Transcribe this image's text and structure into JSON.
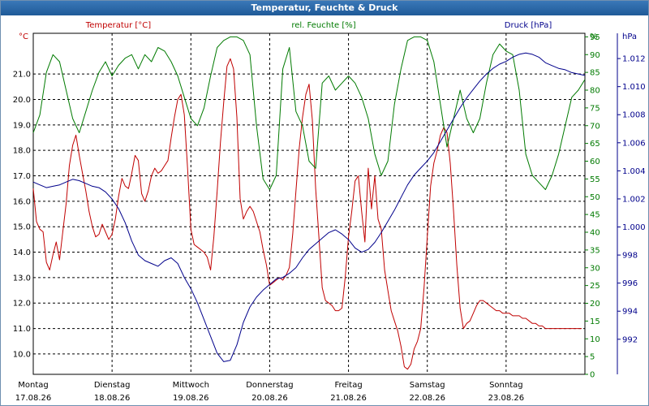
{
  "window": {
    "title": "Temperatur, Feuchte & Druck"
  },
  "colors": {
    "temperature": "#c00000",
    "humidity": "#007a00",
    "pressure": "#00008b",
    "grid": "#000000",
    "axis_label": "#000000"
  },
  "chart_data": {
    "type": "line",
    "title": "Temperatur, Feuchte & Druck",
    "grid": true,
    "x": {
      "range": [
        0,
        168
      ],
      "unit": "hours",
      "ticks": [
        {
          "pos": 0,
          "day": "Montag",
          "date": "17.08.26"
        },
        {
          "pos": 24,
          "day": "Dienstag",
          "date": "18.08.26"
        },
        {
          "pos": 48,
          "day": "Mittwoch",
          "date": "19.08.26"
        },
        {
          "pos": 72,
          "day": "Donnerstag",
          "date": "20.08.26"
        },
        {
          "pos": 96,
          "day": "Freitag",
          "date": "21.08.26"
        },
        {
          "pos": 120,
          "day": "Samstag",
          "date": "22.08.26"
        },
        {
          "pos": 144,
          "day": "Sonntag",
          "date": "23.08.26"
        }
      ]
    },
    "axes": {
      "temperature": {
        "label": "°C",
        "ylim": [
          9.2,
          22.6
        ],
        "ticks": [
          "10.0",
          "11.0",
          "12.0",
          "13.0",
          "14.0",
          "15.0",
          "16.0",
          "17.0",
          "18.0",
          "19.0",
          "20.0",
          "21.0"
        ]
      },
      "humidity": {
        "label": "%",
        "ylim": [
          0,
          96
        ],
        "ticks": [
          "0",
          "5",
          "10",
          "15",
          "20",
          "25",
          "30",
          "35",
          "40",
          "45",
          "50",
          "55",
          "60",
          "65",
          "70",
          "75",
          "80",
          "85",
          "90",
          "95"
        ]
      },
      "pressure": {
        "label": "hPa",
        "ylim": [
          989.5,
          1013.8
        ],
        "ticks": [
          "992",
          "994",
          "996",
          "998",
          "1.000",
          "1.002",
          "1.004",
          "1.006",
          "1.008",
          "1.010",
          "1.012"
        ]
      }
    },
    "series": [
      {
        "name": "Temperatur [°C]",
        "axis": "temperature",
        "x": [
          0,
          1,
          2,
          3,
          4,
          5,
          6,
          7,
          8,
          9,
          10,
          11,
          12,
          13,
          14,
          15,
          16,
          17,
          18,
          19,
          20,
          21,
          22,
          23,
          24,
          25,
          26,
          27,
          28,
          29,
          30,
          31,
          32,
          33,
          34,
          35,
          36,
          37,
          38,
          39,
          40,
          41,
          42,
          43,
          44,
          45,
          46,
          47,
          48,
          49,
          50,
          51,
          52,
          53,
          54,
          55,
          56,
          57,
          58,
          59,
          60,
          61,
          62,
          63,
          64,
          65,
          66,
          67,
          68,
          69,
          70,
          71,
          72,
          73,
          74,
          75,
          76,
          77,
          78,
          79,
          80,
          81,
          82,
          83,
          84,
          85,
          86,
          87,
          88,
          89,
          90,
          91,
          92,
          93,
          94,
          95,
          96,
          97,
          98,
          99,
          100,
          101,
          102,
          103,
          104,
          105,
          106,
          107,
          108,
          109,
          110,
          111,
          112,
          113,
          114,
          115,
          116,
          117,
          118,
          119,
          120,
          121,
          122,
          123,
          124,
          125,
          126,
          127,
          128,
          129,
          130,
          131,
          132,
          133,
          134,
          135,
          136,
          137,
          138,
          139,
          140,
          141,
          142,
          143,
          144,
          145,
          146,
          147,
          148,
          149,
          150,
          151,
          152,
          153,
          154,
          155,
          156,
          157,
          158,
          159,
          160,
          161,
          162,
          163,
          164,
          165,
          166,
          167
        ],
        "values": [
          16.5,
          15.2,
          14.9,
          14.8,
          13.6,
          13.3,
          13.9,
          14.4,
          13.7,
          14.8,
          15.9,
          17.4,
          18.2,
          18.6,
          17.8,
          17.1,
          16.4,
          15.6,
          15.0,
          14.6,
          14.7,
          15.1,
          14.8,
          14.5,
          14.7,
          15.3,
          16.2,
          16.9,
          16.6,
          16.5,
          17.1,
          17.8,
          17.6,
          16.3,
          16.0,
          16.4,
          17.0,
          17.3,
          17.1,
          17.2,
          17.4,
          17.6,
          18.5,
          19.3,
          20.0,
          20.2,
          19.4,
          17.3,
          14.9,
          14.3,
          14.2,
          14.1,
          14.0,
          13.8,
          13.3,
          14.6,
          16.4,
          18.3,
          19.9,
          21.3,
          21.6,
          21.2,
          19.3,
          16.1,
          15.3,
          15.6,
          15.8,
          15.6,
          15.2,
          14.8,
          14.1,
          13.5,
          12.7,
          12.8,
          12.9,
          13.0,
          12.9,
          13.1,
          13.4,
          14.7,
          16.4,
          18.1,
          19.3,
          20.2,
          20.6,
          19.2,
          16.5,
          14.6,
          12.6,
          12.1,
          12.0,
          11.9,
          11.7,
          11.7,
          11.8,
          13.0,
          14.6,
          15.6,
          16.8,
          17.0,
          15.6,
          14.4,
          17.3,
          15.7,
          17.0,
          15.3,
          14.9,
          13.3,
          12.5,
          11.7,
          11.3,
          10.9,
          10.3,
          9.5,
          9.4,
          9.6,
          10.2,
          10.5,
          11.0,
          12.6,
          14.6,
          16.6,
          17.5,
          18.0,
          18.6,
          18.9,
          18.7,
          17.5,
          15.6,
          13.5,
          11.8,
          11.0,
          11.2,
          11.3,
          11.6,
          11.9,
          12.1,
          12.1,
          12.0,
          11.9,
          11.8,
          11.7,
          11.7,
          11.6,
          11.6,
          11.6,
          11.5,
          11.5,
          11.5,
          11.4,
          11.4,
          11.3,
          11.2,
          11.2,
          11.1,
          11.1,
          11.0,
          11.0,
          11.0,
          11.0,
          11.0,
          11.0,
          11.0,
          11.0,
          11.0,
          11.0,
          11.0,
          11.0
        ]
      },
      {
        "name": "rel. Feuchte [%]",
        "axis": "humidity",
        "x": [
          0,
          2,
          4,
          6,
          8,
          10,
          12,
          14,
          16,
          18,
          20,
          22,
          24,
          26,
          28,
          30,
          32,
          34,
          36,
          38,
          40,
          42,
          44,
          46,
          48,
          50,
          52,
          54,
          56,
          58,
          60,
          62,
          64,
          66,
          68,
          70,
          72,
          74,
          76,
          78,
          80,
          82,
          84,
          86,
          88,
          90,
          92,
          94,
          96,
          98,
          100,
          102,
          104,
          106,
          108,
          110,
          112,
          114,
          116,
          118,
          120,
          122,
          124,
          126,
          128,
          130,
          132,
          134,
          136,
          138,
          140,
          142,
          144,
          146,
          148,
          150,
          152,
          154,
          156,
          158,
          160,
          162,
          164,
          166,
          168
        ],
        "values": [
          68,
          73,
          85,
          90,
          88,
          80,
          72,
          68,
          74,
          80,
          85,
          88,
          84,
          87,
          89,
          90,
          86,
          90,
          88,
          92,
          91,
          88,
          84,
          78,
          72,
          70,
          75,
          84,
          92,
          94,
          95,
          95,
          94,
          90,
          70,
          55,
          52,
          56,
          86,
          92,
          74,
          70,
          60,
          58,
          82,
          84,
          80,
          82,
          84,
          82,
          78,
          72,
          62,
          56,
          60,
          76,
          86,
          94,
          95,
          95,
          94,
          88,
          76,
          64,
          72,
          80,
          72,
          68,
          72,
          82,
          90,
          93,
          91,
          90,
          80,
          62,
          56,
          54,
          52,
          56,
          62,
          70,
          78,
          80,
          83
        ]
      },
      {
        "name": "Druck [hPa]",
        "axis": "pressure",
        "x": [
          0,
          2,
          4,
          6,
          8,
          10,
          12,
          14,
          16,
          18,
          20,
          22,
          24,
          26,
          28,
          30,
          32,
          34,
          36,
          38,
          40,
          42,
          44,
          46,
          48,
          50,
          52,
          54,
          56,
          58,
          60,
          62,
          64,
          66,
          68,
          70,
          72,
          74,
          76,
          78,
          80,
          82,
          84,
          86,
          88,
          90,
          92,
          94,
          96,
          98,
          100,
          102,
          104,
          106,
          108,
          110,
          112,
          114,
          116,
          118,
          120,
          122,
          124,
          126,
          128,
          130,
          132,
          134,
          136,
          138,
          140,
          142,
          144,
          146,
          148,
          150,
          152,
          154,
          156,
          158,
          160,
          162,
          164,
          166,
          168
        ],
        "values": [
          1003.2,
          1003.0,
          1002.8,
          1002.9,
          1003.0,
          1003.2,
          1003.4,
          1003.3,
          1003.1,
          1002.9,
          1002.8,
          1002.5,
          1002.0,
          1001.3,
          1000.3,
          999.0,
          998.0,
          997.6,
          997.4,
          997.2,
          997.6,
          997.8,
          997.4,
          996.4,
          995.6,
          994.6,
          993.4,
          992.2,
          991.0,
          990.4,
          990.5,
          991.6,
          993.2,
          994.3,
          995.0,
          995.5,
          995.9,
          996.3,
          996.4,
          996.7,
          997.1,
          997.8,
          998.4,
          998.8,
          999.2,
          999.6,
          999.8,
          999.5,
          999.1,
          998.5,
          998.2,
          998.4,
          998.9,
          999.6,
          1000.4,
          1001.2,
          1002.1,
          1003.0,
          1003.7,
          1004.2,
          1004.7,
          1005.3,
          1006.1,
          1006.9,
          1007.7,
          1008.5,
          1009.2,
          1009.8,
          1010.4,
          1010.9,
          1011.3,
          1011.6,
          1011.8,
          1012.1,
          1012.3,
          1012.4,
          1012.3,
          1012.1,
          1011.7,
          1011.5,
          1011.3,
          1011.2,
          1011.0,
          1010.9,
          1010.8
        ]
      }
    ],
    "series_labels_top": [
      "Temperatur [°C]",
      "rel. Feuchte [%]",
      "Druck [hPa]"
    ]
  }
}
